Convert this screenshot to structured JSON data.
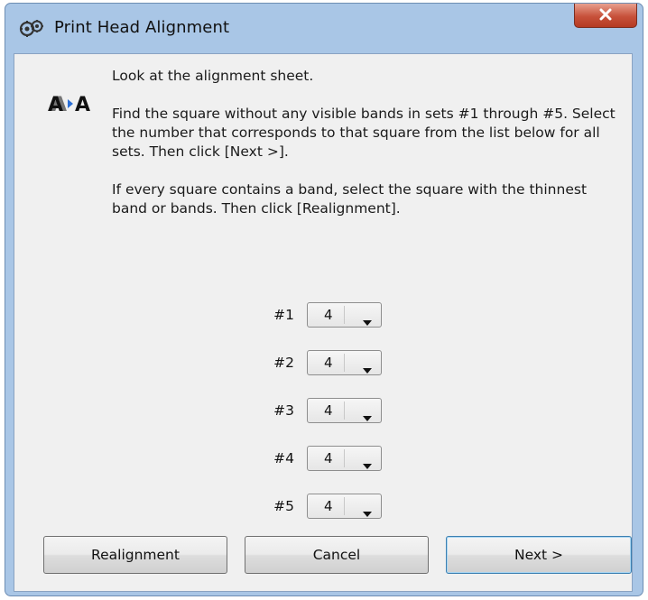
{
  "window": {
    "title": "Print Head Alignment",
    "close_glyph": "x",
    "app_icon": "printer-gears-icon"
  },
  "content": {
    "icon": "alignment-a-arrow-a-icon",
    "instruction_1": "Look at the alignment sheet.",
    "instruction_2": "Find the square without any visible bands in sets #1 through #5. Select the number that corresponds to that square from the list below for all sets. Then click [Next >].",
    "instruction_3": "If every square contains a band, select the square with the thinnest band or bands. Then click [Realignment]."
  },
  "sets": [
    {
      "label": "#1",
      "value": "4"
    },
    {
      "label": "#2",
      "value": "4"
    },
    {
      "label": "#3",
      "value": "4"
    },
    {
      "label": "#4",
      "value": "4"
    },
    {
      "label": "#5",
      "value": "4"
    }
  ],
  "buttons": {
    "realignment": "Realignment",
    "cancel": "Cancel",
    "next": "Next >"
  },
  "colors": {
    "frame": "#a9c6e6",
    "client": "#f0f0f0",
    "close_button": "#c7513a",
    "default_button_border": "#3c7fb1"
  }
}
